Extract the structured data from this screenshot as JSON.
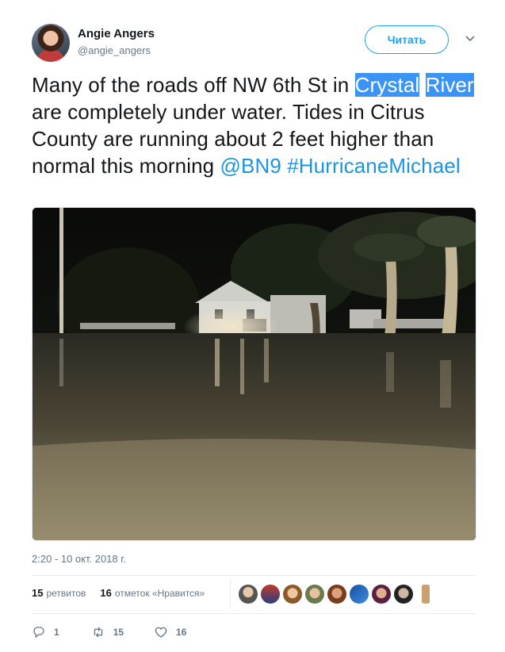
{
  "author": {
    "name": "Angie Angers",
    "handle": "@angie_angers"
  },
  "follow_button": {
    "label": "Читать"
  },
  "tweet": {
    "text_1": "Many of the roads off NW 6th St in ",
    "highlight_1": "Crystal",
    "text_2": " ",
    "highlight_2": "River",
    "text_3": " are completely under water. Tides in Citrus County are running about 2 feet higher than normal this morning ",
    "mention": "@BN9",
    "hashtag": "#HurricaneMichael"
  },
  "timestamp": "2:20 - 10 окт. 2018 г.",
  "stats": {
    "retweets_count": "15",
    "retweets_label": "ретвитов",
    "likes_count": "16",
    "likes_label": "отметок «Нравится»"
  },
  "actions": {
    "reply_count": "1",
    "retweet_count": "15",
    "like_count": "16"
  },
  "colors": {
    "accent": "#1da1f2",
    "highlight": "#3b94f3",
    "secondary_text": "#657786"
  },
  "icons": [
    "chevron-down-icon",
    "reply-icon",
    "retweet-icon",
    "like-icon"
  ]
}
